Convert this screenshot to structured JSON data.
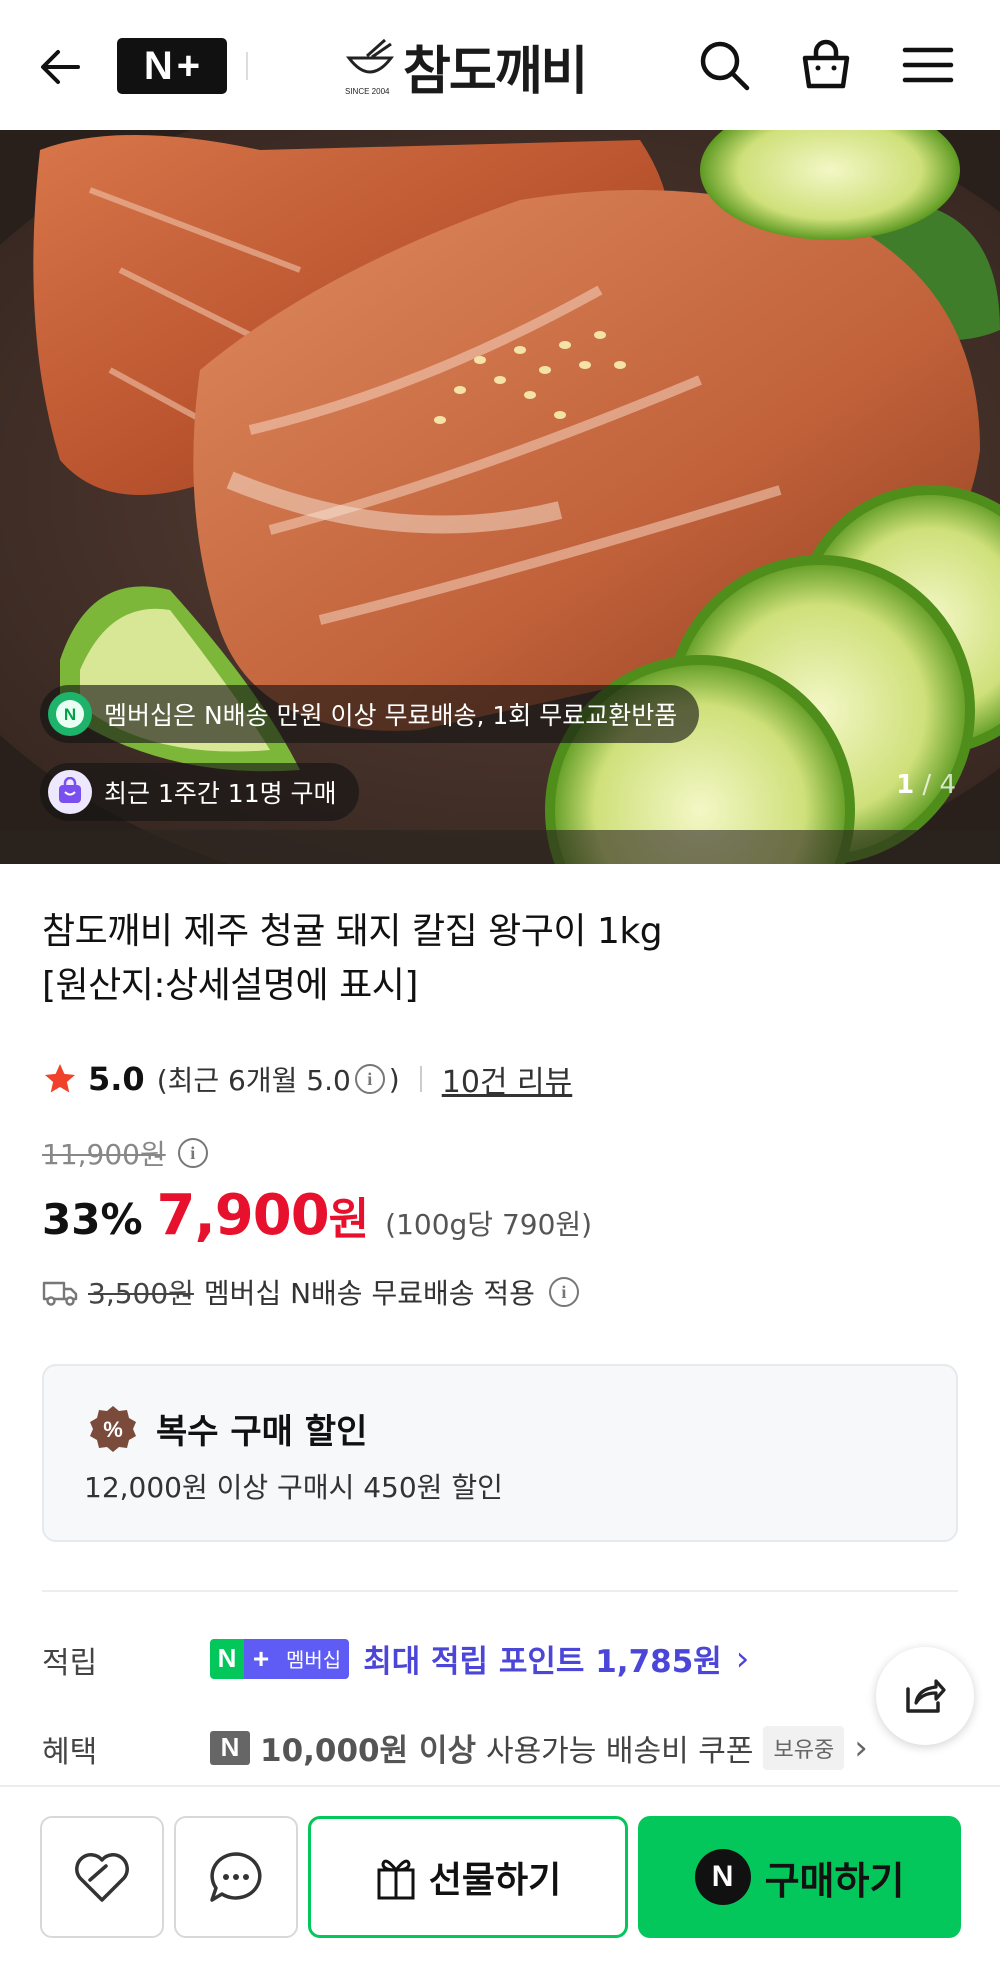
{
  "header": {
    "back_icon": "arrow-left-icon",
    "membership_logo_n": "N",
    "membership_logo_plus": "+",
    "store_name": "참도깨비",
    "store_since": "SINCE 2004",
    "icons": [
      "search-icon",
      "cart-icon",
      "menu-icon"
    ]
  },
  "hero": {
    "membership_pill": "멤버십은 N배송 만원 이상 무료배송, 1회 무료교환반품",
    "recent_buy_pill": "최근 1주간 11명 구매",
    "pager_current": "1",
    "pager_total": " / 4"
  },
  "product": {
    "title_line1": "참도깨비 제주 청귤 돼지 칼집 왕구이 1kg",
    "title_line2": "[원산지:상세설명에 표시]",
    "rating": "5.0",
    "recent_rating_label": "(최근 6개월 5.0",
    "recent_rating_close": ")",
    "review_count": "10건 리뷰",
    "original_price": "11,900원",
    "discount_pct": "33%",
    "sale_price": "7,900",
    "won": "원",
    "unit_price": "(100g당 790원)",
    "shipping_fee": "3,500원",
    "shipping_text": "멤버십 N배송 무료배송 적용"
  },
  "multi_discount": {
    "title": "복수 구매 할인",
    "desc": "12,000원 이상 구매시 450원 할인"
  },
  "points": {
    "label": "적립",
    "badge_text": "멤버십",
    "text": "최대 적립 포인트 1,785원"
  },
  "benefit": {
    "label": "혜택",
    "strong": "10,000원 이상",
    "text": "사용가능 배송비 쿠폰",
    "hold": "보유중"
  },
  "bottom_bar": {
    "gift_label": "선물하기",
    "buy_label": "구매하기",
    "buy_n": "N"
  },
  "colors": {
    "accent_green": "#03c75a",
    "price_red": "#e8112d",
    "point_purple": "#4c46d8"
  }
}
